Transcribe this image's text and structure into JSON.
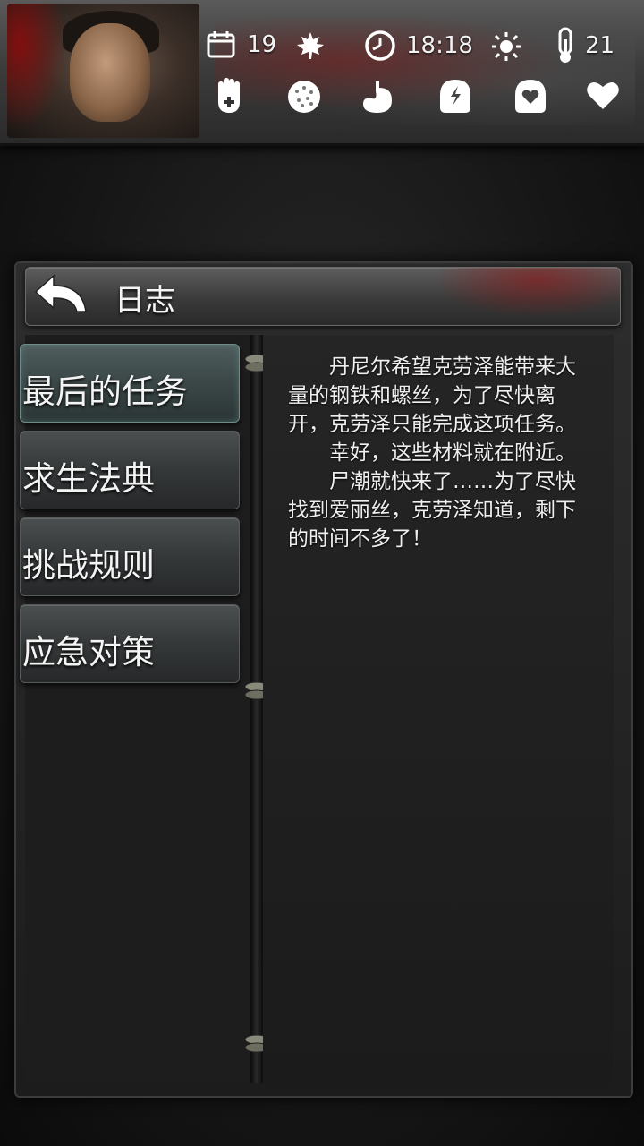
{
  "hud": {
    "day": "19",
    "season_icon": "maple-leaf-icon",
    "time": "18:18",
    "weather_icon": "sun-icon",
    "temperature": "21",
    "status_icons": [
      "health-hand-icon",
      "fatigue-icon",
      "stomach-icon",
      "mental-icon",
      "mood-icon",
      "heart-icon"
    ]
  },
  "journal": {
    "title": "日志",
    "menu": [
      {
        "label": "最后的任务",
        "active": true
      },
      {
        "label": "求生法典",
        "active": false
      },
      {
        "label": "挑战规则",
        "active": false
      },
      {
        "label": "应急对策",
        "active": false
      }
    ],
    "paragraphs": [
      "丹尼尔希望克劳泽能带来大量的钢铁和螺丝，为了尽快离开，克劳泽只能完成这项任务。",
      "幸好，这些材料就在附近。",
      "尸潮就快来了……为了尽快找到爱丽丝，克劳泽知道，剩下的时间不多了！"
    ]
  }
}
